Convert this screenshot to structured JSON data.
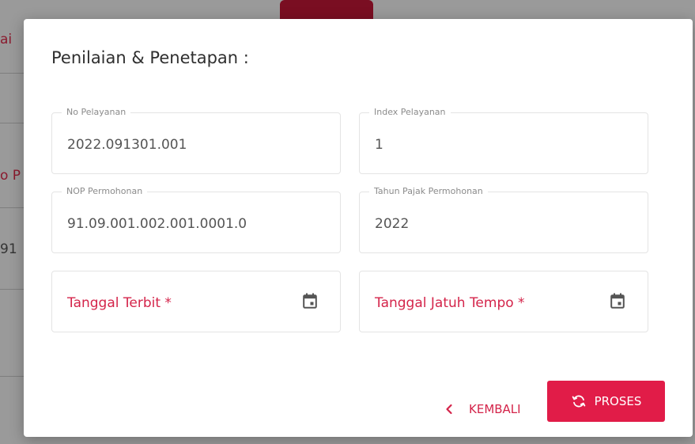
{
  "background": {
    "fragments": [
      "ai",
      "o P",
      "91"
    ]
  },
  "dialog": {
    "title": "Penilaian & Penetapan :",
    "fields": [
      {
        "label": "No Pelayanan",
        "value": "2022.091301.001"
      },
      {
        "label": "Index Pelayanan",
        "value": "1"
      },
      {
        "label": "NOP Permohonan",
        "value": "91.09.001.002.001.0001.0"
      },
      {
        "label": "Tahun Pajak Permohonan",
        "value": "2022"
      }
    ],
    "date_fields": [
      {
        "placeholder": "Tanggal Terbit *",
        "icon": "calendar-icon"
      },
      {
        "placeholder": "Tanggal Jatuh Tempo *",
        "icon": "calendar-icon"
      }
    ],
    "buttons": {
      "back_label": "KEMBALI",
      "back_icon": "chevron-left-icon",
      "process_label": "PROSES",
      "process_icon": "sync-icon"
    }
  },
  "colors": {
    "accent": "#e11c48",
    "backdrop": "#8a8a8a"
  }
}
